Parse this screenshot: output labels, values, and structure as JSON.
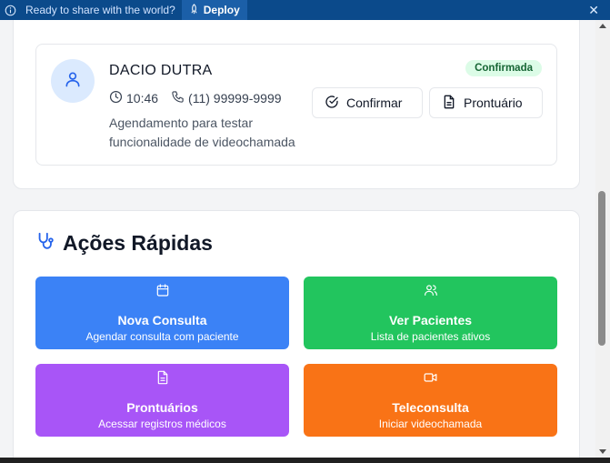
{
  "banner": {
    "ready_text": "Ready to share with the world?",
    "deploy_label": "Deploy"
  },
  "appointment": {
    "patient_name": "DACIO DUTRA",
    "time": "10:46",
    "phone": "(11) 99999-9999",
    "note": "Agendamento para testar funcionalidade de videochamada",
    "status": "Confirmada",
    "confirm_label": "Confirmar",
    "record_label": "Prontuário"
  },
  "quick_actions": {
    "title": "Ações Rápidas",
    "tiles": [
      {
        "title": "Nova Consulta",
        "subtitle": "Agendar consulta com paciente",
        "icon": "calendar-icon",
        "color": "#3b82f6"
      },
      {
        "title": "Ver Pacientes",
        "subtitle": "Lista de pacientes ativos",
        "icon": "users-icon",
        "color": "#22c55e"
      },
      {
        "title": "Prontuários",
        "subtitle": "Acessar registros médicos",
        "icon": "file-text-icon",
        "color": "#a855f7"
      },
      {
        "title": "Teleconsulta",
        "subtitle": "Iniciar videochamada",
        "icon": "video-icon",
        "color": "#f97316"
      }
    ]
  },
  "colors": {
    "banner_bg": "#0b4a8b",
    "accent_blue": "#2563eb",
    "badge_green_bg": "#dcfce7",
    "badge_green_text": "#166534"
  }
}
